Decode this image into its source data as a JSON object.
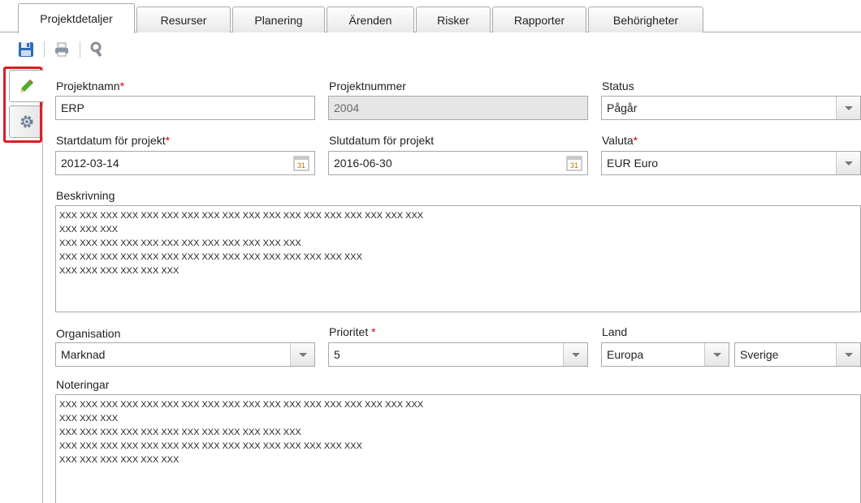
{
  "tabs": [
    {
      "label": "Projektdetaljer",
      "active": true
    },
    {
      "label": "Resurser"
    },
    {
      "label": "Planering"
    },
    {
      "label": "Ärenden"
    },
    {
      "label": "Risker"
    },
    {
      "label": "Rapporter"
    },
    {
      "label": "Behörigheter"
    }
  ],
  "toolbar": {
    "save_icon": "save-icon",
    "print_icon": "print-icon",
    "tools_icon": "tools-icon"
  },
  "side_tabs": {
    "edit_icon": "pencil-icon",
    "settings_icon": "gear-icon",
    "highlight_color": "#e01b24"
  },
  "form": {
    "project_name": {
      "label": "Projektnamn",
      "required_mark": "*",
      "value": "ERP"
    },
    "project_number": {
      "label": "Projektnummer",
      "value": "2004"
    },
    "status": {
      "label": "Status",
      "value": "Pågår"
    },
    "start_date": {
      "label": "Startdatum för projekt",
      "required_mark": "*",
      "value": "2012-03-14"
    },
    "end_date": {
      "label": "Slutdatum för projekt",
      "value": "2016-06-30"
    },
    "currency": {
      "label": "Valuta",
      "required_mark": "*",
      "value": "EUR Euro"
    },
    "description": {
      "label": "Beskrivning",
      "lines": [
        "XXX XXX XXX XXX XXX XXX XXX XXX XXX XXX XXX XXX XXX XXX XXX XXX XXX XXX",
        "XXX XXX XXX",
        "XXX XXX XXX XXX XXX XXX XXX XXX XXX XXX XXX XXX",
        "XXX XXX XXX XXX XXX XXX XXX XXX XXX XXX XXX XXX XXX XXX XXX",
        "XXX XXX XXX XXX XXX XXX"
      ]
    },
    "organisation": {
      "label": "Organisation",
      "value": "Marknad"
    },
    "priority": {
      "label": "Prioritet",
      "required_mark": "*",
      "value": "5"
    },
    "country": {
      "label": "Land",
      "region_value": "Europa",
      "country_value": "Sverige"
    },
    "notes": {
      "label": "Noteringar",
      "lines": [
        "XXX XXX XXX XXX XXX XXX XXX XXX XXX XXX XXX XXX XXX XXX XXX XXX XXX XXX",
        "XXX XXX XXX",
        "XXX XXX XXX XXX XXX XXX XXX XXX XXX XXX XXX XXX",
        "XXX XXX XXX XXX XXX XXX XXX XXX XXX XXX XXX XXX XXX XXX XXX",
        "XXX XXX XXX XXX XXX XXX"
      ]
    }
  }
}
